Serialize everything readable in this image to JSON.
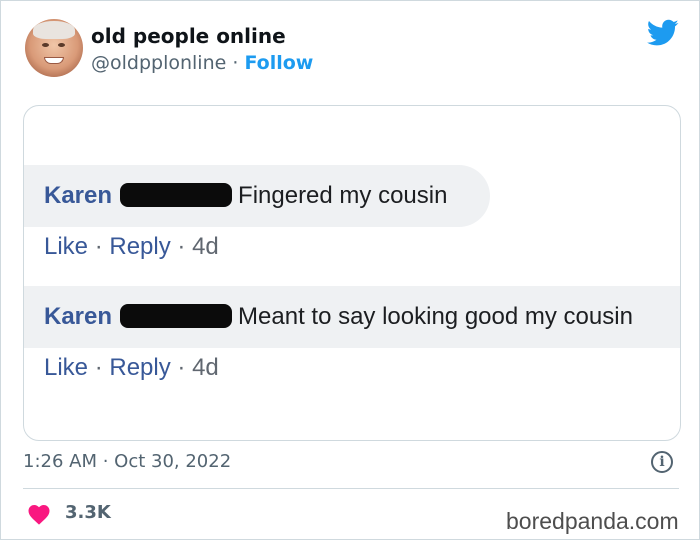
{
  "tweet": {
    "display_name": "old people online",
    "handle": "@oldpplonline",
    "separator": "·",
    "follow_label": "Follow",
    "avatar_icon": "hide-the-pain-face-avatar",
    "platform_icon": "twitter-bird-icon",
    "brand_color": "#1d9bf0",
    "timestamp": "1:26 AM · Oct 30, 2022",
    "info_icon": "info-icon",
    "likes": "3.3K",
    "like_icon": "heart-icon",
    "like_color": "#f91880"
  },
  "embedded_screenshot": {
    "comments": [
      {
        "author": "Karen",
        "text": "Fingered my cousin",
        "like_label": "Like",
        "dot": "·",
        "reply_label": "Reply",
        "age": "4d"
      },
      {
        "author": "Karen",
        "text": "Meant to say looking good my cousin",
        "like_label": "Like",
        "dot": "·",
        "reply_label": "Reply",
        "age": "4d"
      }
    ]
  },
  "watermark": "boredpanda.com"
}
